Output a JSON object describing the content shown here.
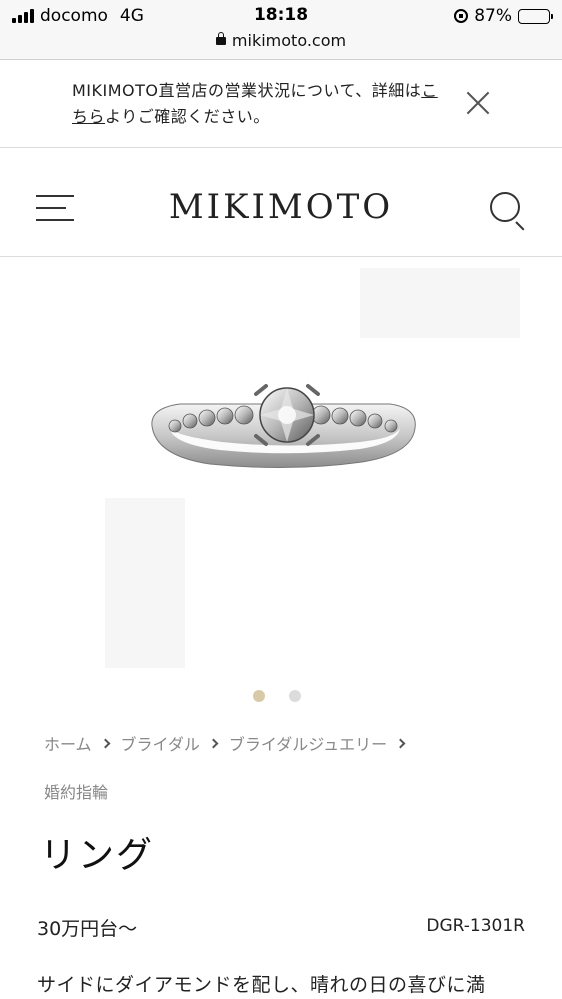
{
  "status_bar": {
    "carrier": "docomo",
    "network": "4G",
    "time": "18:18",
    "battery_percent": "87%",
    "battery_level": 0.87,
    "url": "mikimoto.com"
  },
  "notice": {
    "text_before": "MIKIMOTO直営店の営業状況について、詳細は",
    "link_text": "こちら",
    "text_after": "よりご確認ください。"
  },
  "header": {
    "logo": "MIKIMOTO"
  },
  "carousel": {
    "active_color": "#d8c9a8",
    "inactive_color": "#dcdcdc",
    "current": 1,
    "total": 2
  },
  "breadcrumb": {
    "items": [
      "ホーム",
      "ブライダル",
      "ブライダルジュエリー"
    ],
    "category": "婚約指輪"
  },
  "product": {
    "title": "リング",
    "price": "30万円台〜",
    "code": "DGR-1301R",
    "description": "サイドにダイアモンドを配し、晴れの日の喜びに満"
  }
}
